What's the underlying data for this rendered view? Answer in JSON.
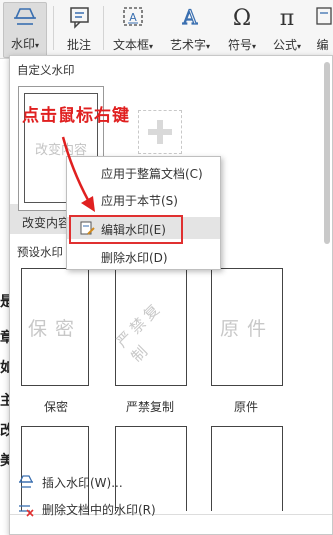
{
  "ribbon": {
    "watermark": "水印",
    "annotation_insert": "批注",
    "textbox": "文本框",
    "wordart": "艺术字",
    "symbol": "符号",
    "formula": "公式",
    "more": "编"
  },
  "doc_edge": [
    "是",
    "章",
    "如",
    "主",
    "改",
    "美"
  ],
  "doc_right": [
    "'",
    "'",
    "'",
    "'",
    "'",
    "'",
    "'",
    "'",
    "'"
  ],
  "panel": {
    "custom_title": "自定义水印",
    "custom_caption": "改变内容",
    "custom_wm_text": "改变内容",
    "preset_title": "预设水印",
    "presets": [
      {
        "wm": "保密",
        "caption": "保密"
      },
      {
        "wm": "严禁复制",
        "caption": "严禁复制"
      },
      {
        "wm": "原件",
        "caption": "原件"
      }
    ],
    "insert_watermark": "插入水印(W)...",
    "remove_watermark": "删除文档中的水印(R)"
  },
  "context_menu": {
    "items": [
      "应用于整篇文档(C)",
      "应用于本节(S)",
      "编辑水印(E)",
      "删除水印(D)"
    ]
  },
  "annotation": "点击鼠标右键",
  "colors": {
    "highlight": "#e03030",
    "annotation": "#e02020"
  }
}
